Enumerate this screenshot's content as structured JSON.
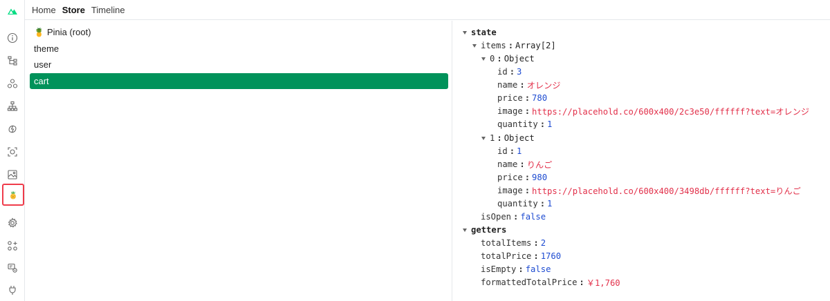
{
  "nav": {
    "tabs": [
      {
        "label": "Home",
        "active": false
      },
      {
        "label": "Store",
        "active": true
      },
      {
        "label": "Timeline",
        "active": false
      }
    ]
  },
  "sidebar": {
    "icons": [
      "nuxt-logo-icon",
      "info-icon",
      "component-tree-icon",
      "graph-icon",
      "hierarchy-icon",
      "timeline-icon",
      "inspect-icon",
      "assets-icon",
      "pinia-icon",
      "settings-icon",
      "modules-icon",
      "server-routes-icon",
      "plug-icon"
    ],
    "active_color": "#ef3b4a",
    "brand_color": "#00dc82"
  },
  "stores": {
    "selected_color": "#00925a",
    "items": [
      {
        "emoji": "🍍",
        "label": "Pinia (root)"
      },
      {
        "emoji": "",
        "label": "theme"
      },
      {
        "emoji": "",
        "label": "user"
      },
      {
        "emoji": "",
        "label": "cart"
      }
    ]
  },
  "inspector": {
    "state_label": "state",
    "items_key": "items",
    "items_val": "Array[2]",
    "item0_key": "0",
    "item0_val": "Object",
    "item0": {
      "id_key": "id",
      "id_val": "3",
      "name_key": "name",
      "name_val": "オレンジ",
      "price_key": "price",
      "price_val": "780",
      "image_key": "image",
      "image_val": "https://placehold.co/600x400/2c3e50/ffffff?text=オレンジ",
      "quantity_key": "quantity",
      "quantity_val": "1"
    },
    "item1_key": "1",
    "item1_val": "Object",
    "item1": {
      "id_key": "id",
      "id_val": "1",
      "name_key": "name",
      "name_val": "りんご",
      "price_key": "price",
      "price_val": "980",
      "image_key": "image",
      "image_val": "https://placehold.co/600x400/3498db/ffffff?text=りんご",
      "quantity_key": "quantity",
      "quantity_val": "1"
    },
    "isopen_key": "isOpen",
    "isopen_val": "false",
    "getters_label": "getters",
    "getters": {
      "totalitems_key": "totalItems",
      "totalitems_val": "2",
      "totalprice_key": "totalPrice",
      "totalprice_val": "1760",
      "isempty_key": "isEmpty",
      "isempty_val": "false",
      "formatted_key": "formattedTotalPrice",
      "formatted_val": "￥1,760"
    }
  }
}
